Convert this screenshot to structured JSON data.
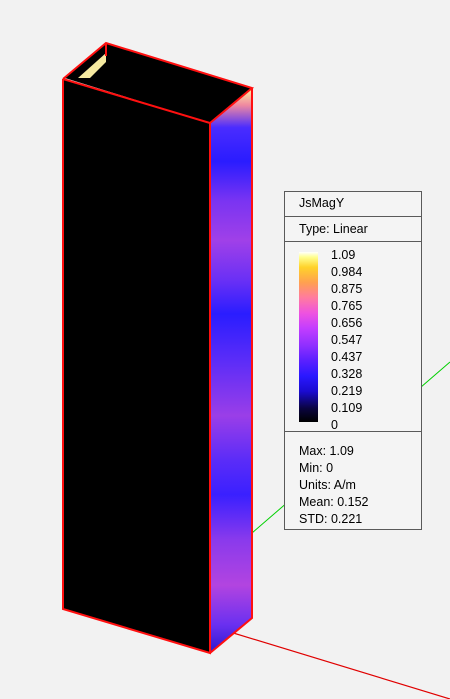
{
  "legend": {
    "title": "JsMagY",
    "type": "Type: Linear",
    "ticks": [
      "1.09",
      "0.984",
      "0.875",
      "0.765",
      "0.656",
      "0.547",
      "0.437",
      "0.328",
      "0.219",
      "0.109",
      "0"
    ],
    "stats": {
      "max": "Max: 1.09",
      "min": "Min: 0",
      "units": "Units: A/m",
      "mean": "Mean: 0.152",
      "std": "STD: 0.221"
    }
  },
  "colors": {
    "background": "#f2f2f2",
    "edge": "#ff0000",
    "face": "#000000",
    "axis_green": "#00d000",
    "axis_red": "#e00000"
  }
}
